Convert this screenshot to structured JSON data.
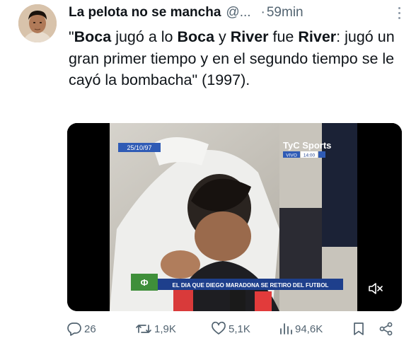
{
  "author": {
    "name": "La pelota no se mancha",
    "handle": "@...",
    "separator": "·",
    "time": "59min"
  },
  "tweet": {
    "segments": [
      {
        "text": "\"",
        "bold": false
      },
      {
        "text": "Boca",
        "bold": true
      },
      {
        "text": " jugó a lo ",
        "bold": false
      },
      {
        "text": "Boca",
        "bold": true
      },
      {
        "text": " y ",
        "bold": false
      },
      {
        "text": "River",
        "bold": true
      },
      {
        "text": " fue ",
        "bold": false
      },
      {
        "text": "River",
        "bold": true
      },
      {
        "text": ": jugó un gran primer tiempo y en el segundo tiempo se le cayó la bombacha\" (1997).",
        "bold": false
      }
    ]
  },
  "media": {
    "date_bug": "25/10/97",
    "channel_logo": "TyC Sports",
    "live_label": "VIVO",
    "clock": "14:00",
    "chyron": "EL DIA QUE DIEGO MARADONA SE RETIRO DEL FUTBOL",
    "mute_icon": "speaker-muted-icon"
  },
  "actions": {
    "replies": "26",
    "reposts": "1,9K",
    "likes": "5,1K",
    "views": "94,6K"
  },
  "colors": {
    "text": "#0f1419",
    "secondary": "#536471",
    "chyron_bg": "#1e3f8c"
  }
}
